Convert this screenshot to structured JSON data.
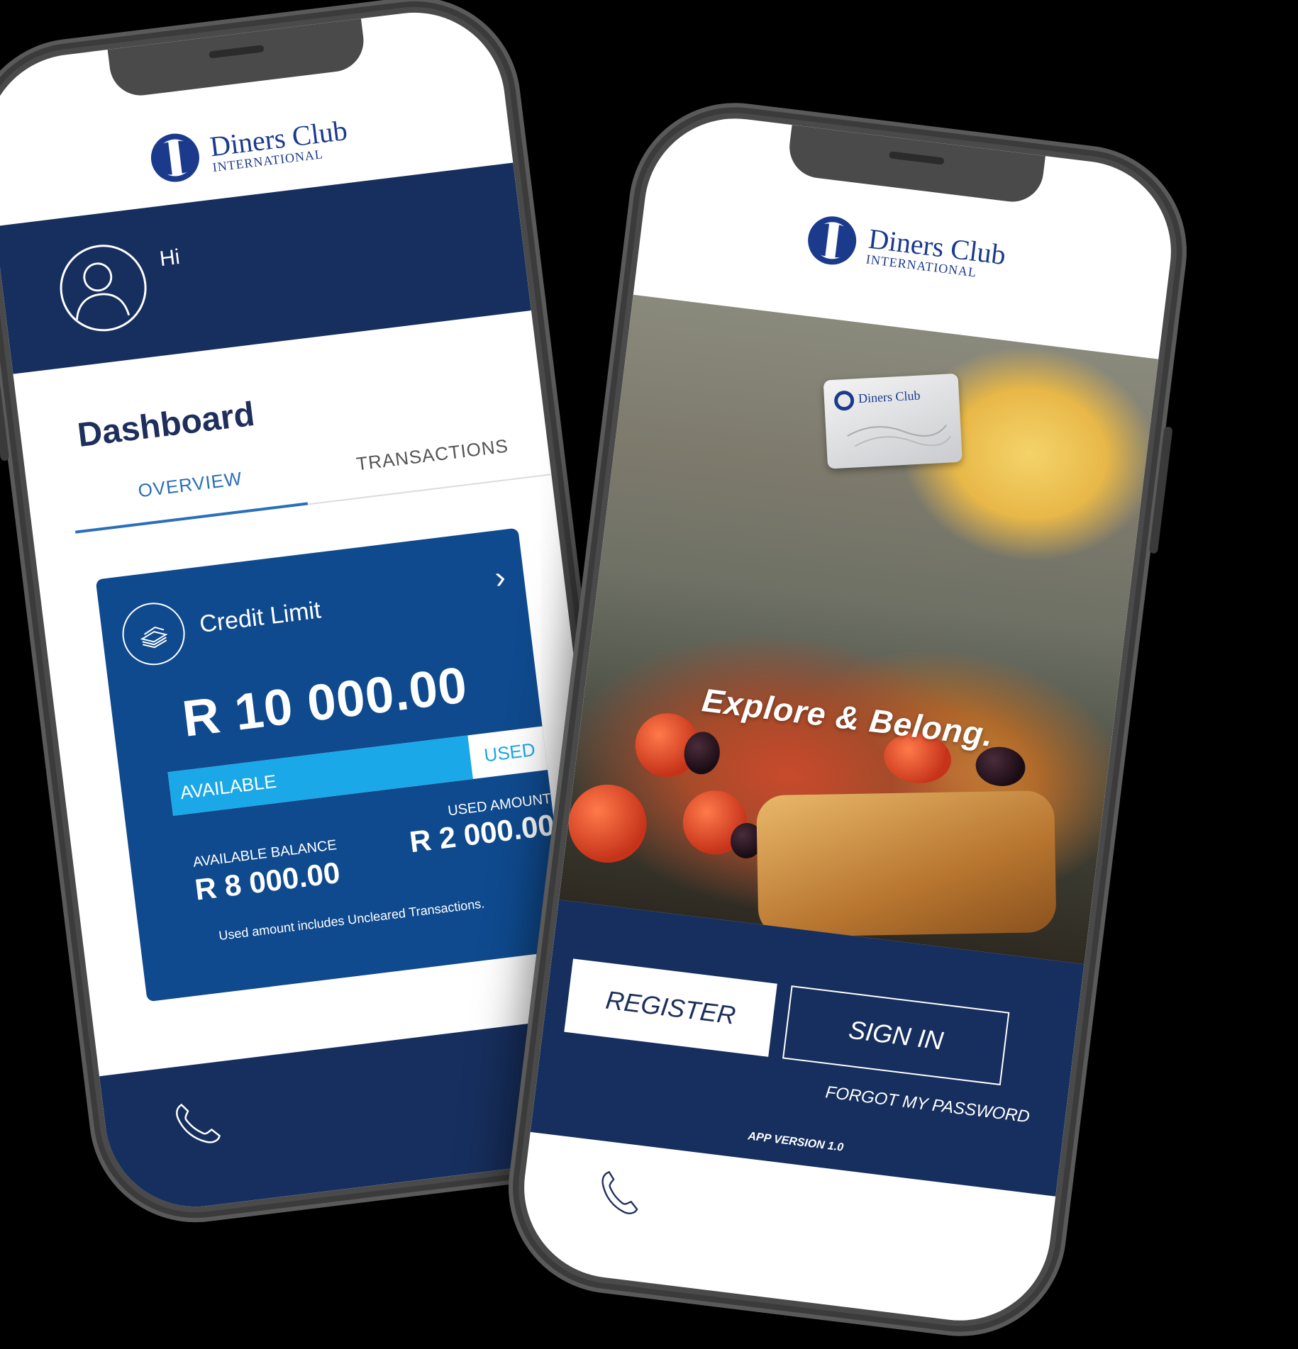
{
  "brand": {
    "line1": "Diners Club",
    "line2": "INTERNATIONAL",
    "color": "#1b3a8c"
  },
  "dashboard_phone": {
    "greeting": "Hi",
    "title": "Dashboard",
    "tabs": [
      {
        "label": "OVERVIEW",
        "active": true
      },
      {
        "label": "TRANSACTIONS",
        "active": false
      }
    ],
    "credit_card": {
      "title": "Credit Limit",
      "limit": "R 10 000.00",
      "bar_available_label": "AVAILABLE",
      "bar_used_label": "USED",
      "available_fraction": 0.8,
      "available_balance_label": "AVAILABLE BALANCE",
      "available_balance": "R 8 000.00",
      "used_amount_label": "USED AMOUNT",
      "used_amount": "R 2 000.00",
      "note": "Used amount includes Uncleared Transactions."
    },
    "bottom_icon": "phone-icon"
  },
  "login_phone": {
    "tagline": "Explore & Belong.",
    "register_label": "REGISTER",
    "signin_label": "SIGN IN",
    "forgot_label": "FORGOT MY PASSWORD",
    "version": "APP VERSION 1.0",
    "bottom_icon": "phone-icon"
  },
  "colors": {
    "navy": "#172f5e",
    "card_blue": "#0f4a8e",
    "accent_cyan": "#1ba8e8",
    "tab_blue": "#2a6fb8"
  }
}
